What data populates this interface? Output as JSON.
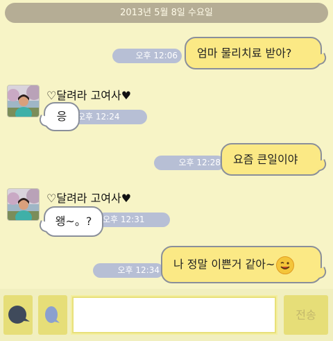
{
  "date_header": "2013년 5월 8일 수요일",
  "messages": [
    {
      "type": "sent",
      "time": "오후 12:06",
      "text": "엄마 물리치료 받아?"
    },
    {
      "type": "received",
      "sender": "♡달려라 고여사♥",
      "time": "오후 12:24",
      "text": "응"
    },
    {
      "type": "sent",
      "time": "오후 12:28",
      "text": "요즘 큰일이야"
    },
    {
      "type": "received",
      "sender": "♡달려라 고여사♥",
      "time": "오후 12:31",
      "text": "왱~。?"
    },
    {
      "type": "sent",
      "time": "오후 12:34",
      "text": "나 정말 이쁜거 같아~",
      "emoji": "winking-smiley-icon"
    }
  ],
  "input": {
    "value": "",
    "placeholder": ""
  },
  "send_label": "전송",
  "colors": {
    "background": "#f7f4c6",
    "sent_bubble": "#fbe985",
    "received_bubble": "#ffffff",
    "timestamp_pill": "#b7bfd5",
    "date_pill": "#b5ad95"
  }
}
